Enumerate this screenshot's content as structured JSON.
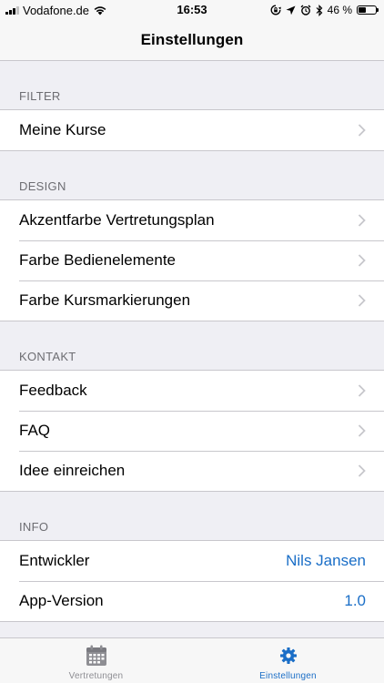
{
  "status_bar": {
    "carrier": "Vodafone.de",
    "time": "16:53",
    "battery": "46 %",
    "battery_level": 0.46,
    "icons": [
      "signal-icon",
      "wifi-icon",
      "screen-lock-icon",
      "location-icon",
      "alarm-icon",
      "bluetooth-icon",
      "battery-icon"
    ]
  },
  "nav": {
    "title": "Einstellungen"
  },
  "sections": {
    "filter": {
      "header": "FILTER",
      "rows": [
        "Meine Kurse"
      ]
    },
    "design": {
      "header": "DESIGN",
      "rows": [
        "Akzentfarbe Vertretungsplan",
        "Farbe Bedienelemente",
        "Farbe Kursmarkierungen"
      ]
    },
    "kontakt": {
      "header": "KONTAKT",
      "rows": [
        "Feedback",
        "FAQ",
        "Idee einreichen"
      ]
    },
    "info": {
      "header": "INFO",
      "rows": [
        {
          "label": "Entwickler",
          "value": "Nils Jansen"
        },
        {
          "label": "App-Version",
          "value": "1.0"
        }
      ]
    }
  },
  "tab_bar": {
    "tabs": [
      {
        "label": "Vertretungen",
        "icon": "calendar-icon",
        "active": false
      },
      {
        "label": "Einstellungen",
        "icon": "gear-icon",
        "active": true
      }
    ]
  },
  "colors": {
    "accent": "#1a6ec7",
    "background": "#efeff4",
    "inactive": "#8e8e93",
    "separator": "#c8c7cc"
  }
}
